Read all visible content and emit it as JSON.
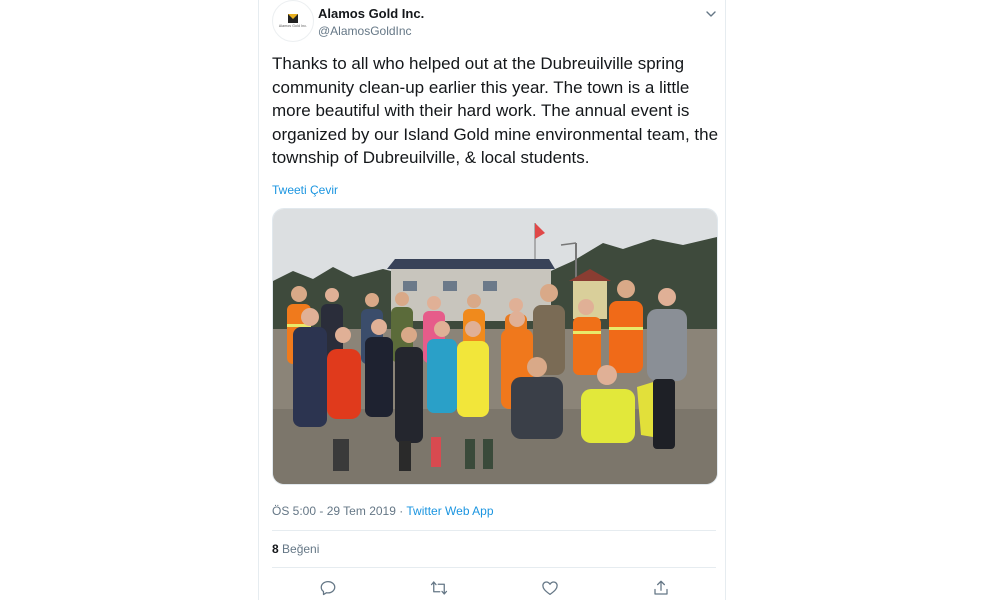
{
  "tweet": {
    "author": {
      "name": "Alamos Gold Inc.",
      "handle": "@AlamosGoldInc",
      "logo_text": "Alamos Gold Inc."
    },
    "text": "Thanks to all who helped out at the Dubreuilville spring community clean-up earlier this year. The town is a little more beautiful with their hard work. The annual event is organized by our Island Gold mine environmental team, the township of Dubreuilville, & local students.",
    "translate_label": "Tweeti Çevir",
    "meta": {
      "time": "ÖS 5:00",
      "date": "29 Tem 2019",
      "separator": "·",
      "source": "Twitter Web App"
    },
    "likes": {
      "count": "8",
      "label": "Beğeni"
    }
  },
  "icons": {
    "menu": "chevron-down-icon",
    "reply": "reply-icon",
    "retweet": "retweet-icon",
    "like": "heart-icon",
    "share": "share-icon"
  },
  "colors": {
    "link": "#1b95e0",
    "secondary_text": "#657786",
    "primary_text": "#14171a",
    "border": "#e6ecf0"
  }
}
